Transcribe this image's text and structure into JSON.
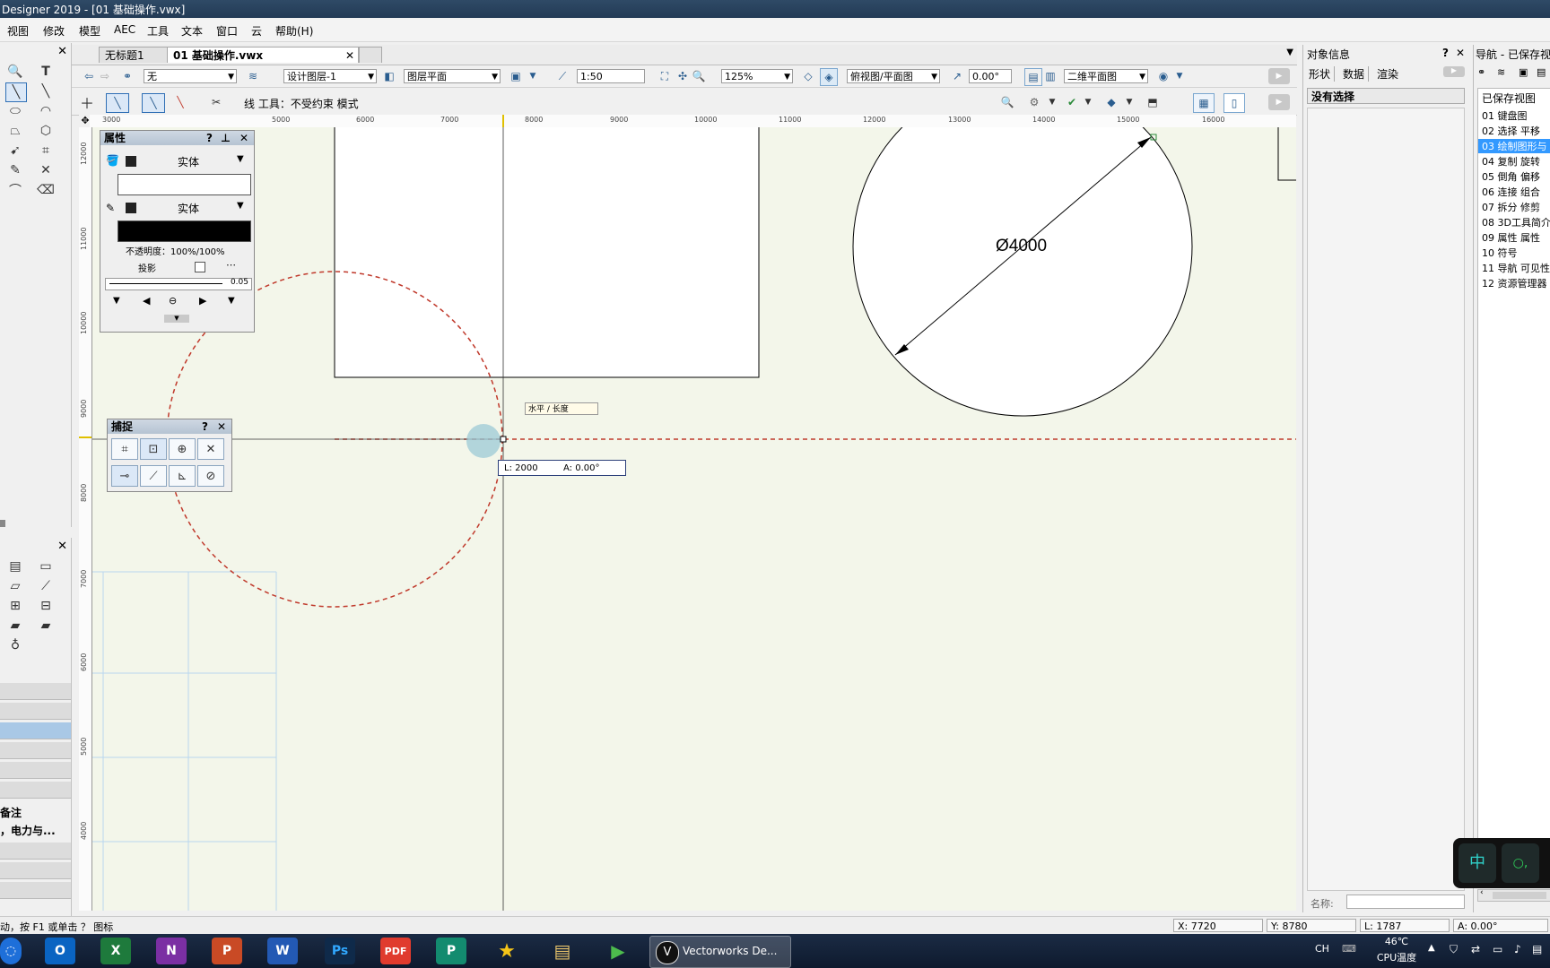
{
  "window": {
    "title": "Designer 2019 - [01 基础操作.vwx]"
  },
  "menu": [
    "视图",
    "修改",
    "模型",
    "AEC",
    "工具",
    "文本",
    "窗口",
    "云",
    "帮助(H)"
  ],
  "doc_tabs": {
    "untitled": "无标题1",
    "active": "01 基础操作.vwx"
  },
  "toolbar": {
    "class_select": "无",
    "layer_select": "设计图层-1",
    "plane_select": "图层平面",
    "scale": "1:50",
    "zoom": "125%",
    "view_select": "俯视图/平面图",
    "rotation": "0.00°",
    "render_select": "二维平面图"
  },
  "modebar": {
    "tool_info": "线 工具：不受约束 模式"
  },
  "ruler": {
    "h_ticks": [
      "3000",
      "5000",
      "6000",
      "7000",
      "8000",
      "9000",
      "10000",
      "11000",
      "12000",
      "13000",
      "14000",
      "15000",
      "16000"
    ],
    "v_ticks": [
      "12000",
      "11000",
      "10000",
      "9000",
      "8000",
      "7000",
      "6000",
      "5000",
      "4000"
    ]
  },
  "attributes_panel": {
    "title": "属性",
    "fill_style": "实体",
    "pen_style": "实体",
    "opacity": "不透明度：100%/100%",
    "shadow": "投影",
    "line_weight": "0.05"
  },
  "snap_panel": {
    "title": "捕捉"
  },
  "canvas": {
    "dimension_label": "Ø4000",
    "snap_hint": "水平 / 长度",
    "length_readout": "L: 2000",
    "angle_readout": "A: 0.00°"
  },
  "object_info": {
    "title": "对象信息",
    "tabs": [
      "形状",
      "数据",
      "渲染"
    ],
    "selection": "没有选择",
    "name_label": "名称:"
  },
  "navigation": {
    "title": "导航 - 已保存视图",
    "header": "已保存视图",
    "items": [
      "01 键盘图",
      "02 选择 平移",
      "03 绘制图形与",
      "04 复制 旋转",
      "05 倒角 偏移",
      "06 连接 组合",
      "07 拆分 修剪",
      "08 3D工具简介",
      "09 属性 属性",
      "10 符号",
      "11 导航 可见性",
      "12 资源管理器"
    ]
  },
  "left_lower": {
    "note": "备注",
    "power": "，电力与..."
  },
  "status": {
    "hint": "动，按 F1 或单击 ？ 图标",
    "x": "X: 7720",
    "y": "Y: 8780",
    "l": "L: 1787",
    "a": "A: 0.00°"
  },
  "taskbar": {
    "vectorworks": "Vectorworks De...",
    "lang": "CH",
    "temp": "46℃",
    "cpu": "CPU温度",
    "ime": "中"
  },
  "colors": {
    "accent": "#2f6fb5",
    "canvas_bg": "#f3f6ea",
    "guide_red": "#c0392b"
  }
}
